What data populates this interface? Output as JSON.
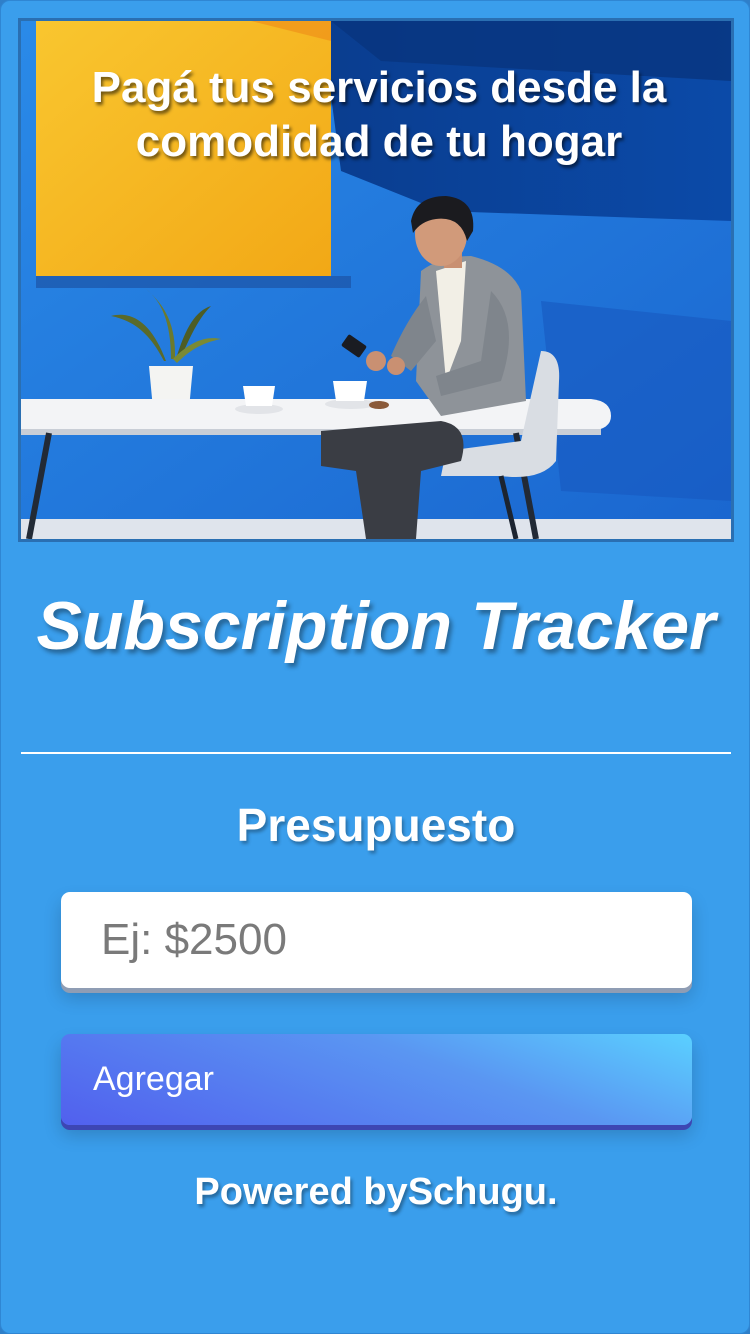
{
  "hero": {
    "headline": "Pagá tus servicios desde la comodidad de tu hogar",
    "illustration": "man-using-phone-at-table"
  },
  "app_title": "Subscription Tracker",
  "budget": {
    "label": "Presupuesto",
    "input_value": "",
    "input_placeholder": "Ej: $2500"
  },
  "actions": {
    "add_label": "Agregar"
  },
  "footer": {
    "powered_by": "Powered bySchugu."
  },
  "colors": {
    "background": "#3a9eec",
    "hero_wall": "#1e73d6",
    "hero_yellow": "#f7b21f",
    "button_gradient_start": "#5ad0ff",
    "button_gradient_end": "#5160ee",
    "input_background": "#ffffff",
    "text": "#ffffff"
  }
}
